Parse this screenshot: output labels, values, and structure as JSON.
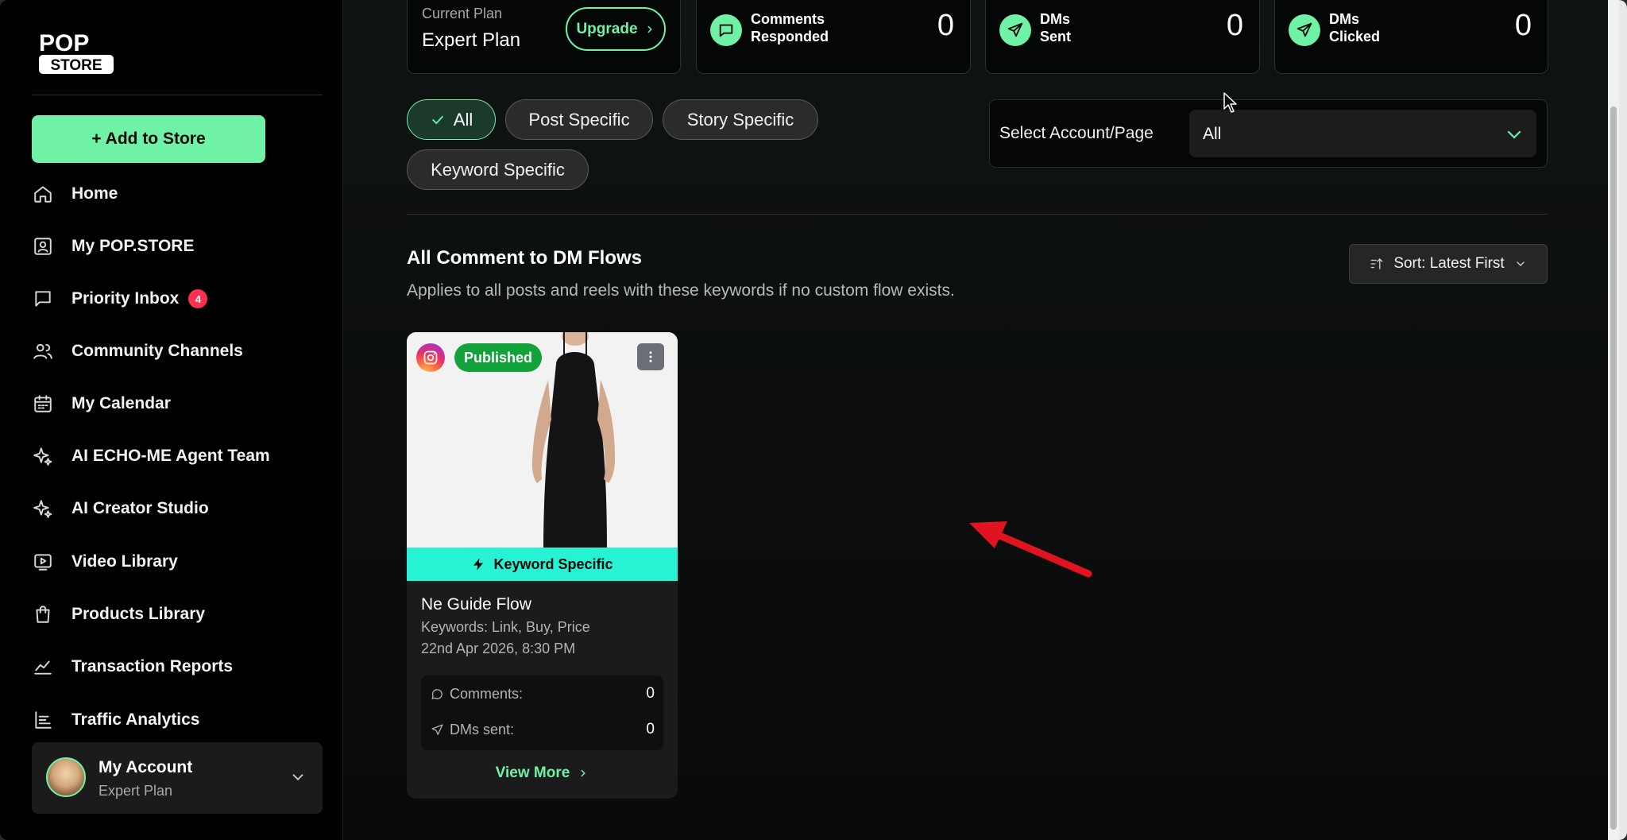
{
  "brand": {
    "logo_top": "POP",
    "logo_bottom": "STORE"
  },
  "sidebar": {
    "add_button": "+ Add to Store",
    "items": [
      {
        "label": "Home",
        "icon": "home-icon"
      },
      {
        "label": "My POP.STORE",
        "icon": "store-profile-icon"
      },
      {
        "label": "Priority Inbox",
        "icon": "message-square-icon",
        "badge": "4"
      },
      {
        "label": "Community Channels",
        "icon": "users-icon"
      },
      {
        "label": "My Calendar",
        "icon": "calendar-icon"
      },
      {
        "label": "AI ECHO-ME Agent Team",
        "icon": "sparkle-icon"
      },
      {
        "label": "AI Creator Studio",
        "icon": "sparkle-icon"
      },
      {
        "label": "Video Library",
        "icon": "video-icon"
      },
      {
        "label": "Products Library",
        "icon": "shopping-bag-icon"
      },
      {
        "label": "Transaction Reports",
        "icon": "trend-chart-icon"
      },
      {
        "label": "Traffic Analytics",
        "icon": "bar-chart-icon"
      }
    ],
    "account": {
      "name": "My Account",
      "plan": "Expert Plan"
    }
  },
  "stats": {
    "plan": {
      "label": "Current Plan",
      "value": "Expert Plan",
      "upgrade_label": "Upgrade"
    },
    "comments": {
      "label_line1": "Comments",
      "label_line2": "Responded",
      "value": "0"
    },
    "dms_sent": {
      "label_line1": "DMs",
      "label_line2": "Sent",
      "value": "0"
    },
    "dms_clicked": {
      "label_line1": "DMs",
      "label_line2": "Clicked",
      "value": "0"
    }
  },
  "filters": {
    "chips": [
      "All",
      "Post Specific",
      "Story Specific",
      "Keyword Specific"
    ],
    "active": "All",
    "account_select": {
      "label": "Select Account/Page",
      "value": "All"
    }
  },
  "section": {
    "title": "All Comment to DM Flows",
    "subtitle": "Applies to all posts and reels with these keywords if no custom flow exists.",
    "sort_label": "Sort: Latest First"
  },
  "flow_card": {
    "status": "Published",
    "type": "Keyword Specific",
    "name": "Ne Guide Flow",
    "keywords": "Keywords: Link, Buy, Price",
    "date": "22nd Apr 2026, 8:30 PM",
    "comments_label": "Comments:",
    "comments_value": "0",
    "dms_label": "DMs sent:",
    "dms_value": "0",
    "view_more": "View More"
  },
  "colors": {
    "accent": "#6ff2a6",
    "keyword_bar": "#27f2d4",
    "published": "#13a23a",
    "badge": "#ff2f4f"
  }
}
